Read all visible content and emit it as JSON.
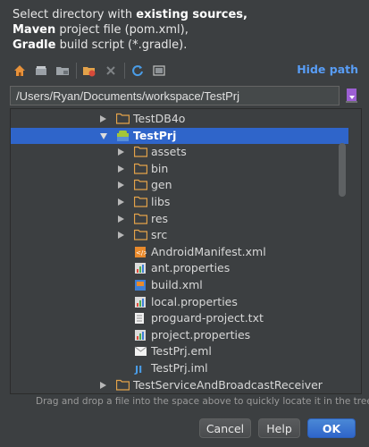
{
  "header": {
    "line1_prefix": "Select directory with ",
    "line1_bold": "existing sources,",
    "line2_bold": "Maven",
    "line2_rest": " project file (pom.xml),",
    "line3_bold": "Gradle",
    "line3_rest": " build script (*.gradle)."
  },
  "toolbar": {
    "hide_path": "Hide path",
    "icons": [
      "home-icon",
      "desktop-icon",
      "project-folder-icon",
      "new-folder-icon",
      "delete-icon",
      "refresh-icon",
      "show-hidden-icon"
    ]
  },
  "path": {
    "value": "/Users/Ryan/Documents/workspace/TestPrj"
  },
  "tree": {
    "items": [
      {
        "label": "TestDB4o",
        "type": "folder",
        "level": 0,
        "expanded": false
      },
      {
        "label": "TestPrj",
        "type": "android-module",
        "level": 0,
        "expanded": true,
        "selected": true
      },
      {
        "label": "assets",
        "type": "folder",
        "level": 1,
        "expanded": false
      },
      {
        "label": "bin",
        "type": "folder",
        "level": 1,
        "expanded": false
      },
      {
        "label": "gen",
        "type": "folder",
        "level": 1,
        "expanded": false
      },
      {
        "label": "libs",
        "type": "folder",
        "level": 1,
        "expanded": false
      },
      {
        "label": "res",
        "type": "folder",
        "level": 1,
        "expanded": false
      },
      {
        "label": "src",
        "type": "folder",
        "level": 1,
        "expanded": false
      },
      {
        "label": "AndroidManifest.xml",
        "type": "xml-file",
        "level": 1
      },
      {
        "label": "ant.properties",
        "type": "properties-file",
        "level": 1
      },
      {
        "label": "build.xml",
        "type": "ant-file",
        "level": 1
      },
      {
        "label": "local.properties",
        "type": "properties-file",
        "level": 1
      },
      {
        "label": "proguard-project.txt",
        "type": "text-file",
        "level": 1
      },
      {
        "label": "project.properties",
        "type": "properties-file",
        "level": 1
      },
      {
        "label": "TestPrj.eml",
        "type": "eml-file",
        "level": 1
      },
      {
        "label": "TestPrj.iml",
        "type": "iml-file",
        "level": 1
      },
      {
        "label": "TestServiceAndBroadcastReceiver",
        "type": "folder",
        "level": 0,
        "expanded": false
      }
    ]
  },
  "footer": {
    "hint": "Drag and drop a file into the space above to quickly locate it in the tree",
    "cancel": "Cancel",
    "help": "Help",
    "ok": "OK"
  },
  "colors": {
    "background": "#3c3f41",
    "selection": "#2f65ca",
    "link": "#589df6",
    "folder": "#e3a24a"
  }
}
